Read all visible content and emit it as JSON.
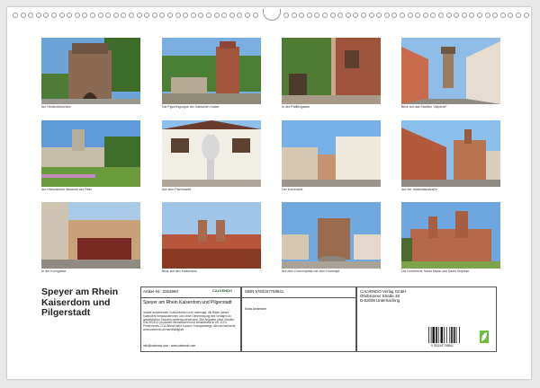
{
  "title_lines": [
    "Speyer am Rhein",
    "Kaiserdom und",
    "Pilgerstadt"
  ],
  "photos": [
    {
      "caption": "Am Heidentürmchen"
    },
    {
      "caption": "Die Figurengruppe der Salischen Kaiser"
    },
    {
      "caption": "In der Pfaffengasse"
    },
    {
      "caption": "Blick auf das Stadttor \"Altpörtel\""
    },
    {
      "caption": "Am Historischen Museum der Pfalz"
    },
    {
      "caption": "Auf dem Fischmarkt"
    },
    {
      "caption": "Der Kornmarkt"
    },
    {
      "caption": "Auf der Maximilianstraße"
    },
    {
      "caption": "In der Korngasse"
    },
    {
      "caption": "Blick auf den Kaiserdom"
    },
    {
      "caption": "Auf dem Domvorplatz mit dem Domnapf"
    },
    {
      "caption": "Die Domkirche Sankt Maria und Sankt Stephan"
    }
  ],
  "info": {
    "article_label": "Artikel-Nr.: 2263993",
    "publisher_logo": "CALVENDO",
    "isbn": "ISBN 9783167759541",
    "publisher_name": "CALVENDO Verlag GmbH",
    "publisher_street": "Ottobrunner Straße 39",
    "publisher_city": "D-82008 Unterhaching",
    "product_title": "Speyer am Rhein Kaiserdom und Pilgerstadt",
    "author": "Ilona Andersen",
    "legal_text": "Inhalte bestehender Schutzrechte ist es untersagt, die Bilder dieses Kalenders herauszutrennen und ohne Genehmigung des Verlages zu gewerblichen Zwecken weiterzuverwenden. Alle Angaben ohne Gewähr. CALVENDO produziert klimaeffizient und klimaneutral in DE & EU. Preishinweis CO2-Bilanz beim Kunden Transportwege. Abholt-Nachweis: www.calvendo.de/nachhaltigkeit",
    "contact": "info@calvendo.com · www.calvendo.com",
    "barcode_number": "9 783167 759541"
  }
}
